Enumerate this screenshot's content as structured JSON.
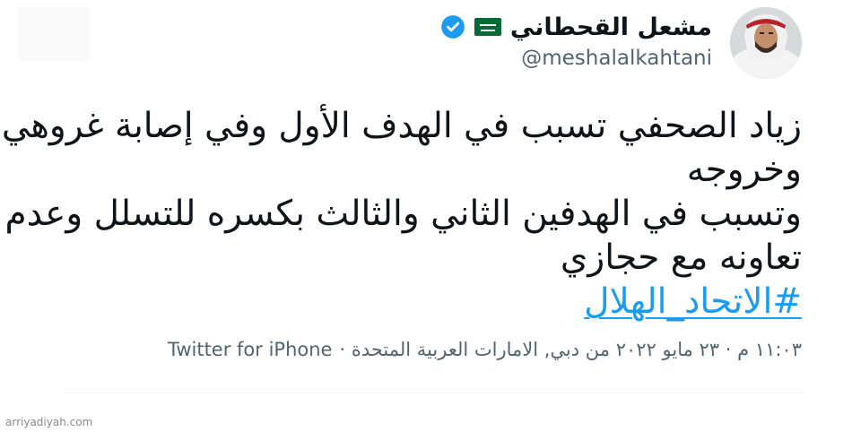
{
  "author": {
    "display_name": "مشعل القحطاني",
    "handle": "@meshalalkahtani",
    "flag_icon": "saudi-flag-icon",
    "verified_icon": "verified-badge-icon"
  },
  "tweet": {
    "lines": [
      "زياد الصحفي تسبب في الهدف الأول وفي إصابة غروهي",
      "وخروجه",
      "وتسبب في الهدفين الثاني والثالث بكسره للتسلل وعدم",
      "تعاونه مع حجازي"
    ],
    "hashtag": "#الاتحاد_الهلال"
  },
  "meta": {
    "time_date_place": "١١:٠٣ م · ٢٣ مايو ٢٠٢٢ من دبي, الامارات العربية المتحدة ·",
    "source": "Twitter for iPhone"
  },
  "watermark": "arriyadiyah.com",
  "colors": {
    "text": "#0f1419",
    "secondary": "#536471",
    "link": "#1d9bf0",
    "verified": "#1d9bf0",
    "flag_green": "#006c35"
  }
}
